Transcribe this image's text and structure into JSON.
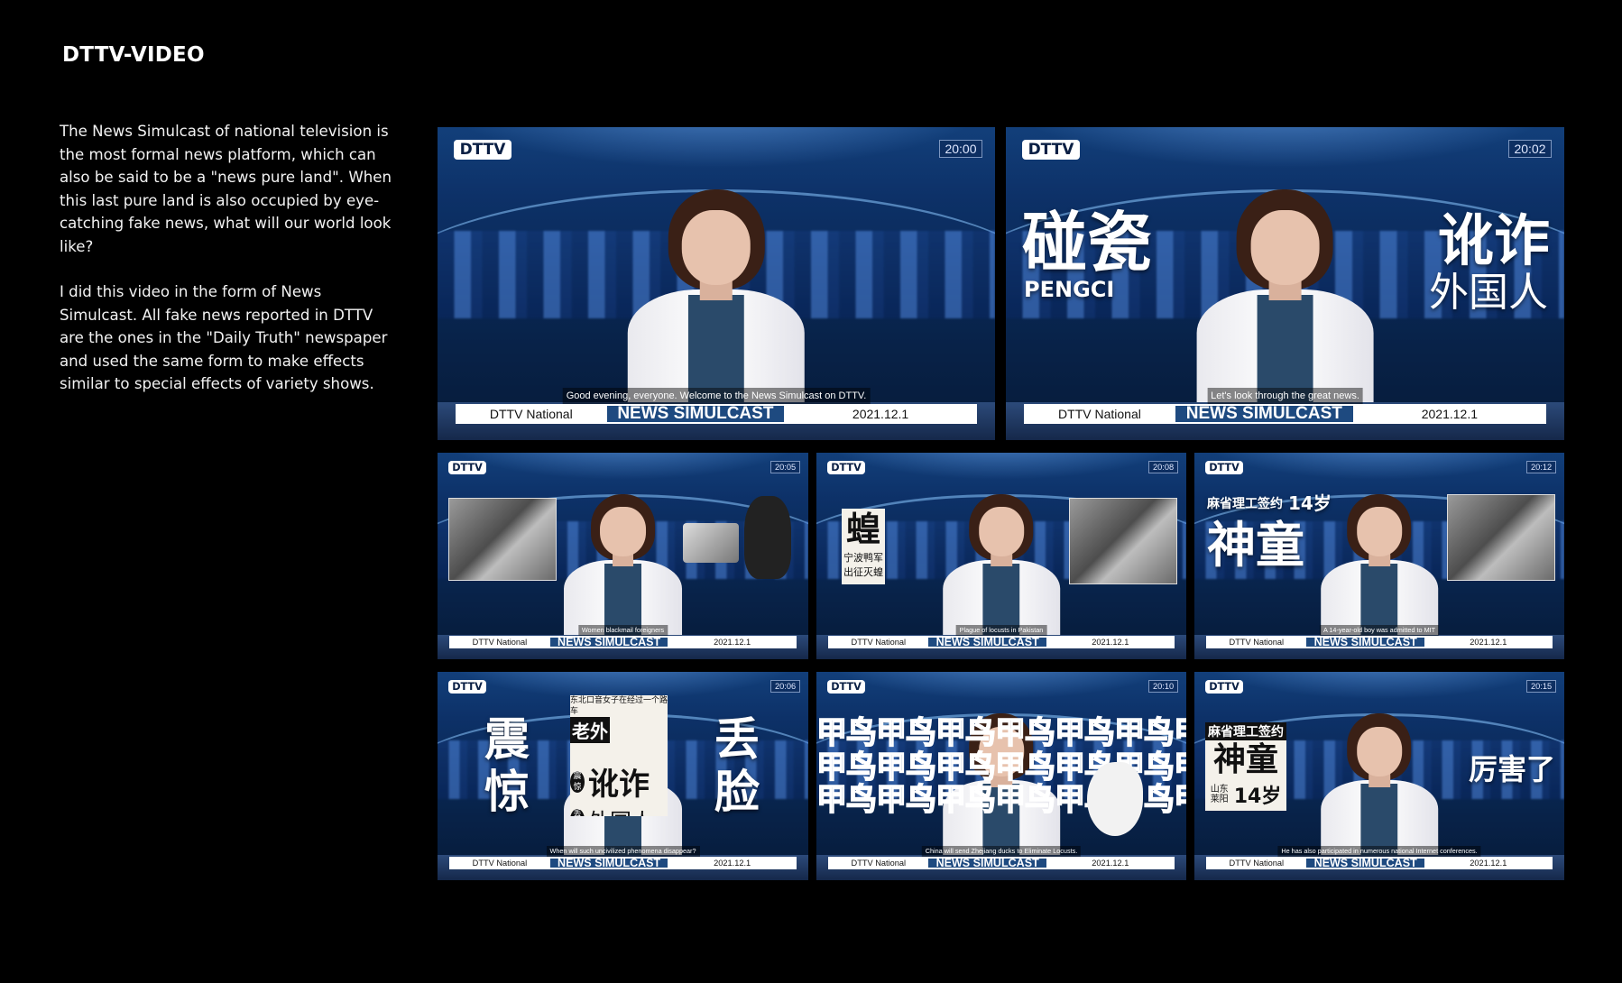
{
  "page_title": "DTTV-VIDEO",
  "description": [
    "The News Simulcast of national television is the most formal news platform, which can also be said to be a \"news pure land\". When this last pure land is also occupied by eye-catching fake news, what will our world look like?",
    "I did this video in the form of News Simulcast. All fake news reported in DTTV are the ones in the \"Daily Truth\" newspaper and used the same form to make effects similar to special effects of variety shows."
  ],
  "common": {
    "logo": "DTTV",
    "lower_left": "DTTV National",
    "lower_mid": "NEWS SIMULCAST",
    "lower_right": "2021.12.1"
  },
  "frames": [
    {
      "time": "20:00",
      "subtitle": "Good evening, everyone. Welcome to the News Simulcast on DTTV."
    },
    {
      "time": "20:02",
      "subtitle": "Let's look through the great news.",
      "left_cn": "碰瓷",
      "left_en": "PENGCI",
      "right_cn_1": "讹诈",
      "right_cn_2": "外国人"
    },
    {
      "time": "20:05",
      "subtitle": "Women blackmail foreigners"
    },
    {
      "time": "20:08",
      "subtitle": "Plague of locusts in Pakistan",
      "paper_char": "蝗",
      "paper_line1": "宁波鸭军",
      "paper_line2": "出征灭蝗"
    },
    {
      "time": "20:12",
      "subtitle": "A 14-year-old boy was admitted to MIT",
      "head_small": "麻省理工签约",
      "head_age": "14岁",
      "head_big": "神童"
    },
    {
      "time": "20:06",
      "subtitle": "When will such uncivilized phenomena disappear?",
      "left_cn": "震惊",
      "right_cn": "丢脸",
      "paper_top": "东北口音女子在经过一个路车",
      "paper_big1": "讹诈",
      "paper_big2": "外国人",
      "paper_old": "老外",
      "paper_tag1": "震惊",
      "paper_tag2": "丢脸"
    },
    {
      "time": "20:10",
      "subtitle": "China will send Zhejiang ducks to Eliminate Locusts.",
      "pattern": "甲鸟甲鸟甲鸟甲鸟甲鸟甲鸟甲鸟"
    },
    {
      "time": "20:15",
      "subtitle": "He has also participated in numerous national Internet conferences.",
      "paper_head": "麻省理工签约",
      "paper_big": "神童",
      "paper_loc": "山东莱阳",
      "paper_age": "14岁",
      "right_cn": "厉害了"
    }
  ]
}
